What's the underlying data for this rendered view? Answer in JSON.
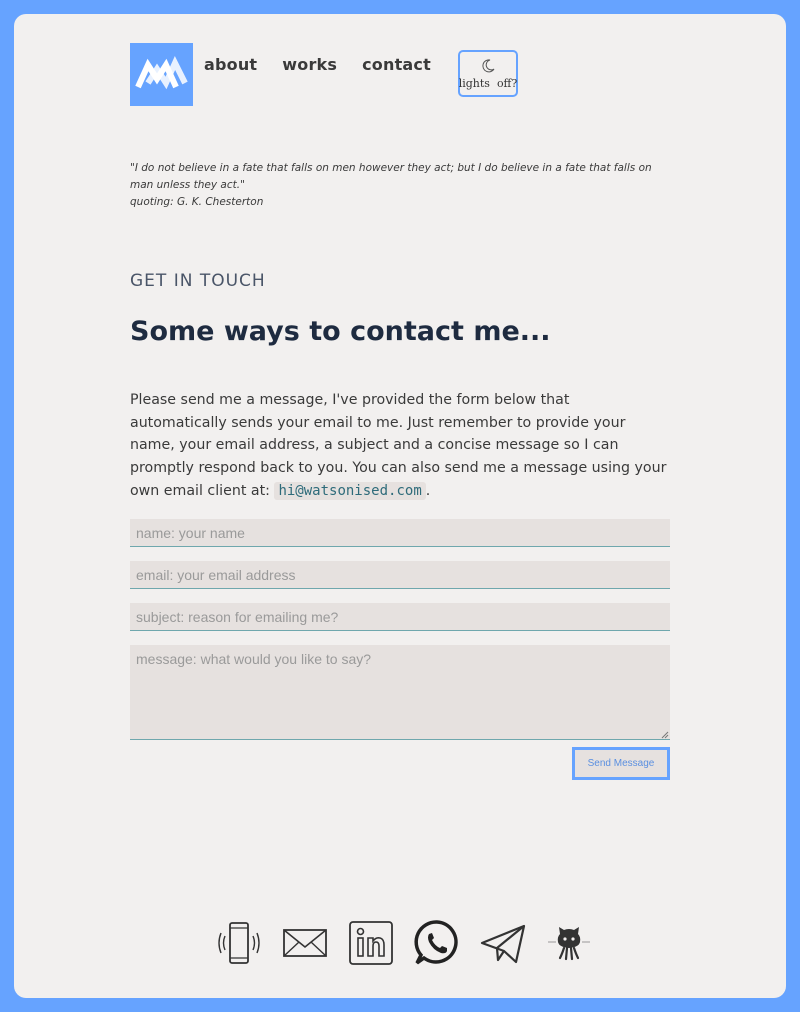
{
  "nav": {
    "items": [
      {
        "label": "about"
      },
      {
        "label": "works"
      },
      {
        "label": "contact"
      }
    ],
    "lights_label": "lights  off?"
  },
  "quote": {
    "text": "\"I do not believe in a fate that falls on men however they act; but I do believe in a fate that falls on man unless they act.\"",
    "attribution": "quoting: G. K. Chesterton"
  },
  "contact": {
    "eyebrow": "GET IN TOUCH",
    "heading": "Some ways to contact me...",
    "intro": "Please send me a message, I've provided the form below that automatically sends your email to me. Just remember to provide your name, your email address, a subject and a concise message so I can promptly respond back to you. You can also send me a message using your own email client at:",
    "email": "hi@watsonised.com",
    "after_email": "."
  },
  "form": {
    "name_placeholder": "name: your name",
    "email_placeholder": "email: your email address",
    "subject_placeholder": "subject: reason for emailing me?",
    "message_placeholder": "message: what would you like to say?",
    "send_label": "Send Message"
  },
  "socials": [
    {
      "icon": "phone-icon"
    },
    {
      "icon": "mail-icon"
    },
    {
      "icon": "linkedin-icon"
    },
    {
      "icon": "whatsapp-icon"
    },
    {
      "icon": "telegram-icon"
    },
    {
      "icon": "github-icon"
    }
  ],
  "colors": {
    "frame": "#66a3ff",
    "background": "#f2f0ef",
    "heading": "#1e2b40",
    "field": "#e6e1df"
  }
}
